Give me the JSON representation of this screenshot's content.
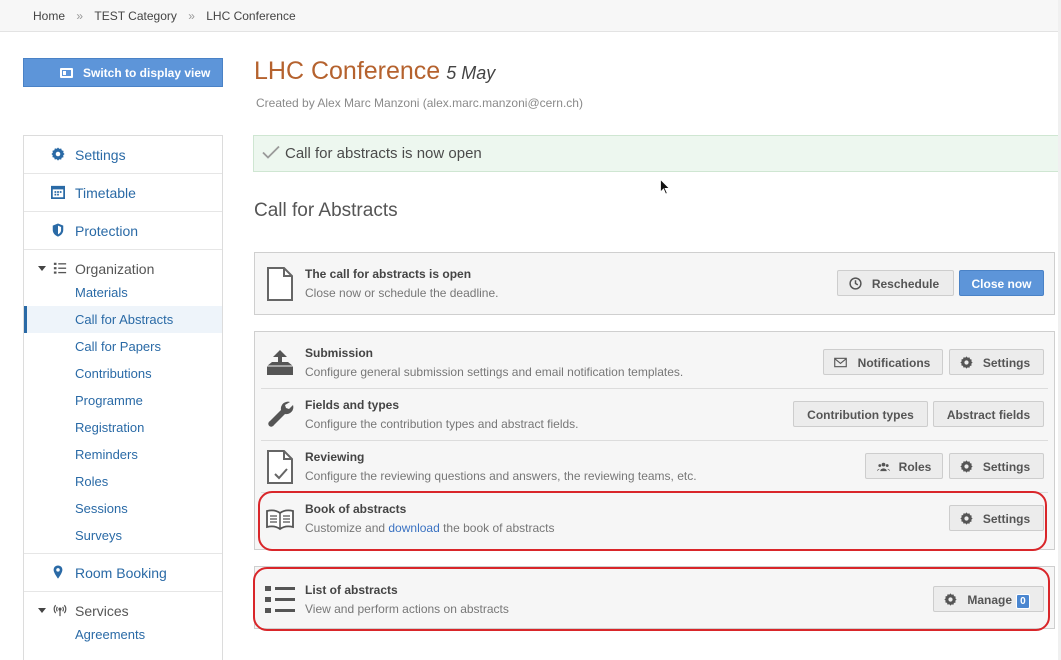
{
  "breadcrumb": {
    "home": "Home",
    "sep1": "»",
    "category": "TEST Category",
    "sep2": "»",
    "current": "LHC Conference"
  },
  "switch_button": {
    "label": "Switch to display view",
    "icon": "display-icon"
  },
  "sidebar": {
    "settings": "Settings",
    "timetable": "Timetable",
    "protection": "Protection",
    "organization": "Organization",
    "organization_items": [
      "Materials",
      "Call for Abstracts",
      "Call for Papers",
      "Contributions",
      "Programme",
      "Registration",
      "Reminders",
      "Roles",
      "Sessions",
      "Surveys"
    ],
    "active_item": "Call for Abstracts",
    "room_booking": "Room Booking",
    "services": "Services",
    "services_items": [
      "Agreements"
    ]
  },
  "event": {
    "title": "LHC Conference",
    "date": "5 May",
    "created_by": "Created by Alex Marc Manzoni (alex.marc.manzoni@cern.ch)"
  },
  "alert": {
    "text": "Call for abstracts is now open"
  },
  "section_title": "Call for Abstracts",
  "status_box": {
    "title": "The call for abstracts is open",
    "desc": "Close now or schedule the deadline.",
    "reschedule": "Reschedule",
    "close_now": "Close now"
  },
  "rows": {
    "submission": {
      "title": "Submission",
      "desc": "Configure general submission settings and email notification templates.",
      "notifications": "Notifications",
      "settings": "Settings"
    },
    "fields": {
      "title": "Fields and types",
      "desc": "Configure the contribution types and abstract fields.",
      "contribution_types": "Contribution types",
      "abstract_fields": "Abstract fields"
    },
    "reviewing": {
      "title": "Reviewing",
      "desc": "Configure the reviewing questions and answers, the reviewing teams, etc.",
      "roles": "Roles",
      "settings": "Settings"
    },
    "book": {
      "title": "Book of abstracts",
      "desc_before": "Customize and ",
      "desc_link": "download",
      "desc_after": " the book of abstracts",
      "settings": "Settings"
    }
  },
  "list_box": {
    "title": "List of abstracts",
    "desc": "View and perform actions on abstracts",
    "manage": "Manage",
    "count": "0"
  },
  "colors": {
    "accent_blue": "#5d95d9",
    "title_orange": "#b5622e",
    "link_blue": "#2a6aa6",
    "highlight_red": "#d9262a",
    "alert_green": "#edf7ef"
  }
}
